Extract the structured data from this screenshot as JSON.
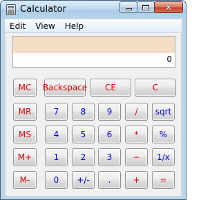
{
  "window": {
    "title": "Calculator",
    "title_icon": "calculator-icon",
    "controls": {
      "minimize_icon": "minimize-icon",
      "maximize_icon": "maximize-icon",
      "close_icon": "close-icon",
      "close_glyph": "✕"
    }
  },
  "menu": [
    "Edit",
    "View",
    "Help"
  ],
  "display": {
    "value": "0",
    "memory_indicator": ""
  },
  "colors": {
    "operator_text": "#e00000",
    "digit_text": "#0000d8",
    "memory_strip": "#f5dcc4"
  },
  "buttons": {
    "mc": "MC",
    "mr": "MR",
    "ms": "MS",
    "m_plus": "M+",
    "m_minus": "M-",
    "backspace": "Backspace",
    "ce": "CE",
    "c": "C",
    "d7": "7",
    "d8": "8",
    "d9": "9",
    "divide": "/",
    "sqrt": "sqrt",
    "d4": "4",
    "d5": "5",
    "d6": "6",
    "multiply": "*",
    "percent": "%",
    "d1": "1",
    "d2": "2",
    "d3": "3",
    "subtract": "−",
    "reciprocal": "1/x",
    "d0": "0",
    "sign": "+/-",
    "decimal": ".",
    "add": "+",
    "equals": "="
  }
}
